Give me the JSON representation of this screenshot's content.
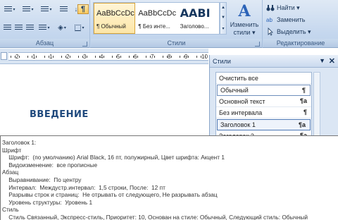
{
  "ribbon": {
    "paragraph": {
      "label": "Абзац",
      "pilcrow": "¶",
      "sort": "↓"
    },
    "styles": {
      "label": "Стили",
      "gallery": [
        {
          "sample": "AaBbCcDc",
          "name": "¶ Обычный",
          "selected": true
        },
        {
          "sample": "AaBbCcDc",
          "name": "¶ Без инте...",
          "selected": false
        },
        {
          "sample": "AABI",
          "name": "Заголово...",
          "selected": false
        }
      ],
      "change_styles_glyph": "A",
      "change_styles_label_1": "Изменить",
      "change_styles_label_2": "стили ▾"
    },
    "editing": {
      "label": "Редактирование",
      "find": "Найти ▾",
      "replace": "Заменить",
      "select": "Выделить ▾"
    }
  },
  "ruler": {
    "numbers": [
      "2",
      "1",
      "1",
      "2",
      "3",
      "4",
      "5",
      "6",
      "7",
      "8",
      "9",
      "10"
    ]
  },
  "document": {
    "heading": "ВВЕДЕНИЕ"
  },
  "styles_pane": {
    "title": "Стили",
    "items": [
      {
        "label": "Очистить все",
        "mark": ""
      },
      {
        "label": "Обычный",
        "mark": "¶"
      },
      {
        "label": "Основной текст",
        "mark": "¶a"
      },
      {
        "label": "Без интервала",
        "mark": "¶"
      },
      {
        "label": "Заголовок 1",
        "mark": "¶a"
      },
      {
        "label": "Заголовок 2",
        "mark": "¶a"
      }
    ]
  },
  "tooltip": {
    "lines": [
      "Заголовок 1:",
      "Шрифт",
      "    Шрифт:  (по умолчанию) Arial Black, 16 пт, полужирный, Цвет шрифта: Акцент 1",
      "    Видоизменение:  все прописные",
      "Абзац",
      "    Выравнивание:  По центру",
      "    Интервал:  Междустр.интервал:  1,5 строки, После:  12 пт",
      "    Разрывы строк и страниц:  Не отрывать от следующего, Не разрывать абзац",
      "    Уровень структуры:  Уровень 1",
      "Стиль",
      "    Стиль Связанный, Экспресс-стиль, Приоритет: 10, Основан на стиле: Обычный, Следующий стиль: Обычный"
    ]
  }
}
